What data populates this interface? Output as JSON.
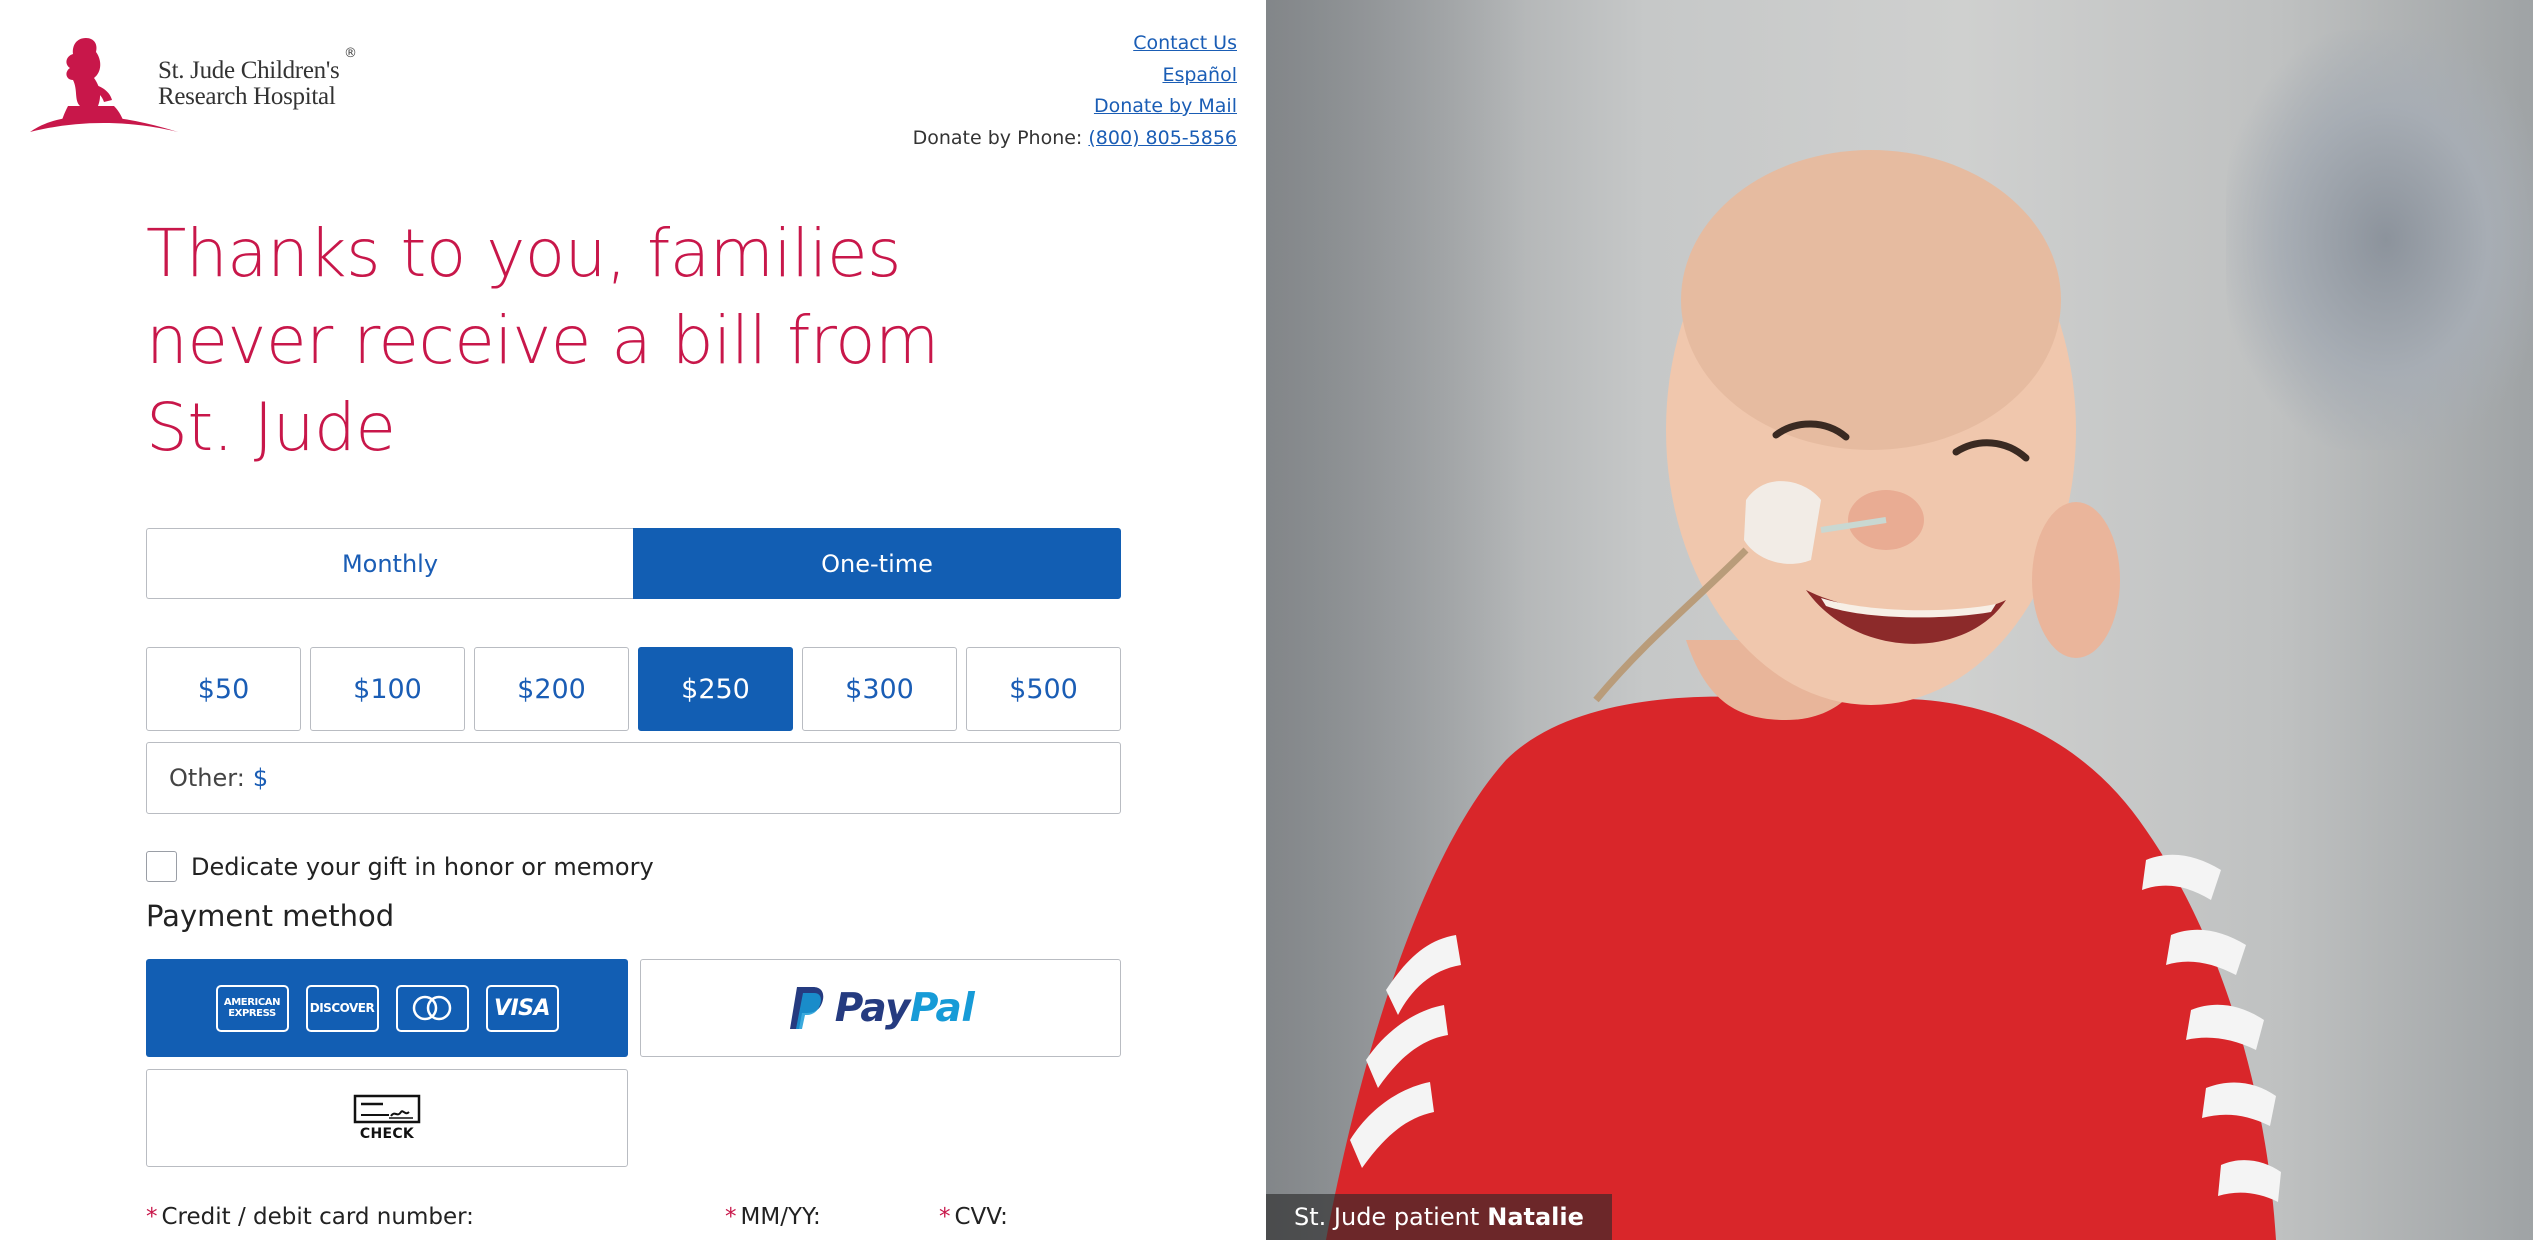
{
  "brand": {
    "name_line1": "St. Jude Children's",
    "name_line2": "Research Hospital",
    "registered": "®",
    "color": "#c8174a"
  },
  "header_links": {
    "contact": "Contact Us",
    "espanol": "Español",
    "mail": "Donate by Mail",
    "phone_prefix": "Donate by Phone:",
    "phone": "(800) 805-5856"
  },
  "headline": {
    "line1": "Thanks to you, families",
    "line2": "never receive a bill from",
    "line3": "St. Jude"
  },
  "frequency": {
    "monthly": "Monthly",
    "onetime": "One-time",
    "selected": "One-time"
  },
  "amounts": {
    "a50": "$50",
    "a100": "$100",
    "a200": "$200",
    "a250": "$250",
    "a300": "$300",
    "a500": "$500",
    "selected": "$250"
  },
  "other": {
    "label": "Other:",
    "currency": "$",
    "value": ""
  },
  "dedicate": {
    "label": "Dedicate your gift in honor or memory",
    "checked": false
  },
  "payment": {
    "label": "Payment method",
    "amex_line1": "AMERICAN",
    "amex_line2": "EXPRESS",
    "discover": "DISCOVER",
    "visa": "VISA",
    "paypal_a": "Pay",
    "paypal_b": "Pal",
    "check": "CHECK",
    "selected": "card"
  },
  "fields": {
    "card_number": "Credit / debit card number:",
    "expiry": "MM/YY:",
    "cvv": "CVV:",
    "required_mark": "*"
  },
  "photo": {
    "caption_prefix": "St. Jude patient",
    "caption_name": "Natalie"
  },
  "colors": {
    "primary_blue": "#125eb3",
    "link_blue": "#1a5db5",
    "border_gray": "#b9bcc2"
  }
}
